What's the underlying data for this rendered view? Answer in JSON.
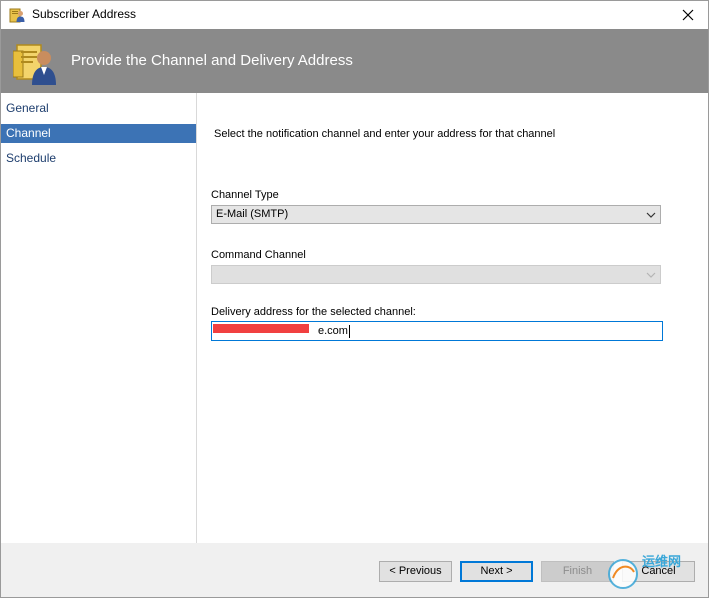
{
  "window": {
    "title": "Subscriber Address",
    "close_glyph": "✕"
  },
  "banner": {
    "title": "Provide the Channel and Delivery Address",
    "icon": "subscriber-address-icon"
  },
  "nav": {
    "items": [
      {
        "label": "General",
        "selected": false
      },
      {
        "label": "Channel",
        "selected": true
      },
      {
        "label": "Schedule",
        "selected": false
      }
    ]
  },
  "main": {
    "instruction": "Select the notification channel and enter your address for that channel",
    "channel_type": {
      "label": "Channel Type",
      "value": "E-Mail (SMTP)"
    },
    "command_channel": {
      "label": "Command Channel",
      "value": ""
    },
    "delivery_address": {
      "label": "Delivery address for the selected channel:",
      "value": "e.com"
    }
  },
  "footer": {
    "previous": "< Previous",
    "next": "Next >",
    "finish": "Finish",
    "cancel": "Cancel"
  },
  "watermark": {
    "text": "运维网"
  },
  "colors": {
    "banner": "#8a8a8a",
    "selection": "#3c73b5",
    "focus": "#0078d7"
  }
}
